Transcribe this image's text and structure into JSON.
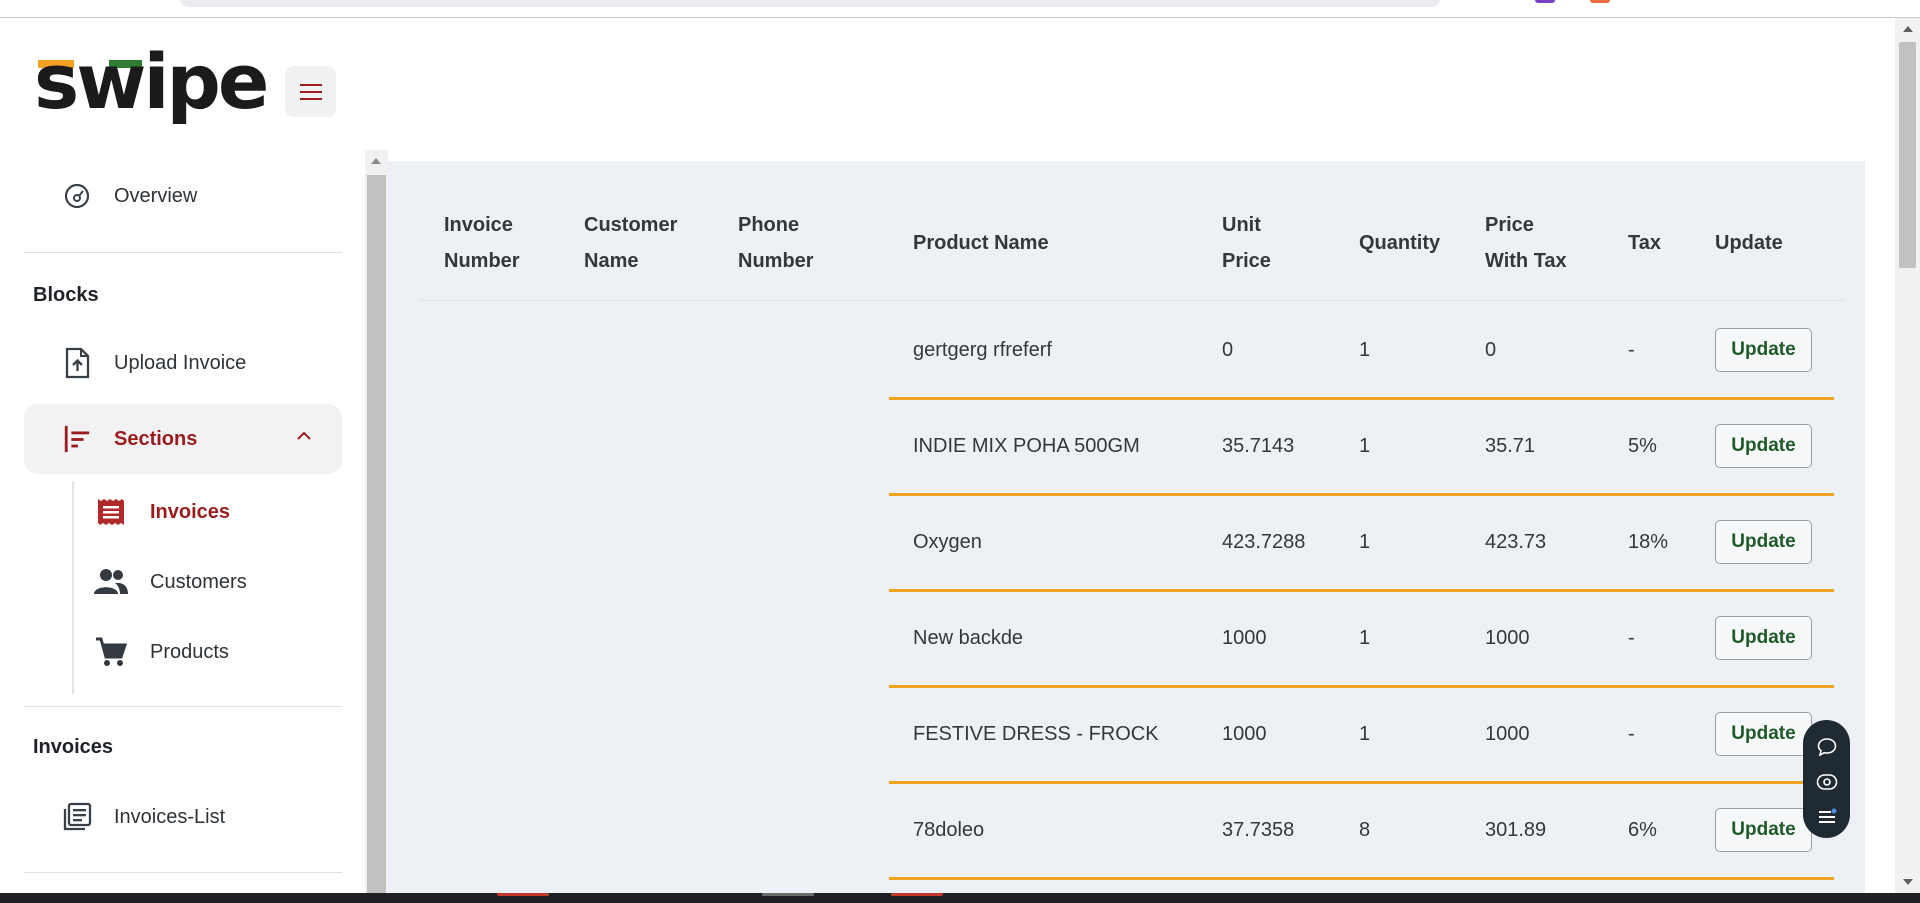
{
  "brand": {
    "logo_text": "swipe",
    "accent_orange": "#F2A321",
    "accent_green": "#2E7D32",
    "accent_red": "#9B1C1C"
  },
  "sidebar": {
    "overview": {
      "label": "Overview",
      "icon": "gauge-icon"
    },
    "blocks_heading": "Blocks",
    "upload_invoice": {
      "label": "Upload Invoice",
      "icon": "file-upload-icon"
    },
    "sections": {
      "label": "Sections",
      "icon": "sections-icon",
      "expanded": true
    },
    "sub_items": [
      {
        "label": "Invoices",
        "icon": "receipt-icon",
        "active": true
      },
      {
        "label": "Customers",
        "icon": "people-icon",
        "active": false
      },
      {
        "label": "Products",
        "icon": "cart-icon",
        "active": false
      }
    ],
    "invoices_heading": "Invoices",
    "invoices_list": {
      "label": "Invoices-List",
      "icon": "list-icon"
    }
  },
  "table": {
    "headers": {
      "invoice_number": "Invoice\nNumber",
      "customer_name": "Customer\nName",
      "phone_number": "Phone\nNumber",
      "product_name": "Product Name",
      "unit_price": "Unit\nPrice",
      "quantity": "Quantity",
      "price_with_tax": "Price\nWith Tax",
      "tax": "Tax",
      "update": "Update"
    },
    "rows": [
      {
        "product": "gertgerg rfreferf",
        "unit_price": "0",
        "quantity": "1",
        "price_with_tax": "0",
        "tax": "-",
        "button": "Update"
      },
      {
        "product": "INDIE MIX POHA 500GM",
        "unit_price": "35.7143",
        "quantity": "1",
        "price_with_tax": "35.71",
        "tax": "5%",
        "button": "Update"
      },
      {
        "product": "Oxygen",
        "unit_price": "423.7288",
        "quantity": "1",
        "price_with_tax": "423.73",
        "tax": "18%",
        "button": "Update"
      },
      {
        "product": "New backde",
        "unit_price": "1000",
        "quantity": "1",
        "price_with_tax": "1000",
        "tax": "-",
        "button": "Update"
      },
      {
        "product": "FESTIVE DRESS - FROCK",
        "unit_price": "1000",
        "quantity": "1",
        "price_with_tax": "1000",
        "tax": "-",
        "button": "Update"
      },
      {
        "product": "78doleo",
        "unit_price": "37.7358",
        "quantity": "8",
        "price_with_tax": "301.89",
        "tax": "6%",
        "button": "Update"
      }
    ]
  },
  "floating_toolbar": {
    "icons": [
      "chat-icon",
      "eye-icon",
      "list-settings-icon"
    ]
  }
}
